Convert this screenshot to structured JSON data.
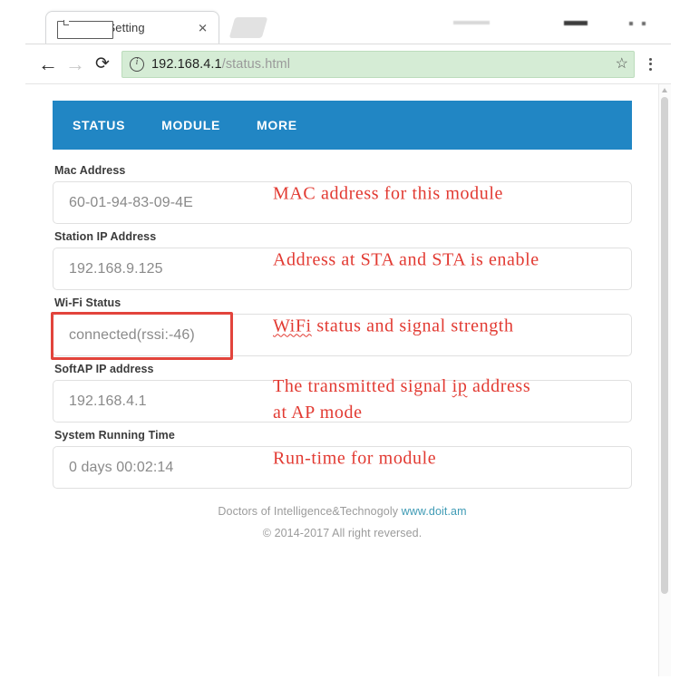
{
  "browser": {
    "tab": {
      "title": "Wi-Fi Setting",
      "close_label": "✕",
      "favicon": "page-icon"
    },
    "new_tab_label": "",
    "window_controls": {
      "minimize": "minimize-icon",
      "maximize": "maximize-icon",
      "close": "close-icon"
    },
    "toolbar": {
      "back_label": "←",
      "forward_label": "→",
      "reload_label": "⟳",
      "site_info_icon": "info-circle-icon",
      "url_host": "192.168.4.1",
      "url_path": "/status.html",
      "bookmark_label": "☆",
      "menu_icon": "three-dot-menu-icon"
    }
  },
  "nav": {
    "items": [
      {
        "label": "STATUS",
        "active": true
      },
      {
        "label": "MODULE",
        "active": false
      },
      {
        "label": "MORE",
        "active": false
      }
    ]
  },
  "fields": [
    {
      "label": "Mac Address",
      "value": "60-01-94-83-09-4E",
      "annotation": "MAC address for this module",
      "highlighted": false
    },
    {
      "label": "Station IP Address",
      "value": "192.168.9.125",
      "annotation": "Address at STA and STA is enable",
      "highlighted": false
    },
    {
      "label": "Wi-Fi Status",
      "value": "connected(rssi:-46)",
      "annotation_prefix": "WiFi",
      "annotation_rest": " status and signal strength",
      "highlighted": true
    },
    {
      "label": "SoftAP IP address",
      "value": "192.168.4.1",
      "annotation_a": "The transmitted signal ",
      "annotation_b": "ip",
      "annotation_c": " address",
      "annotation_d": "at AP mode",
      "highlighted": false
    },
    {
      "label": "System Running Time",
      "value": "0 days 00:02:14",
      "annotation": "Run-time for module",
      "highlighted": false
    }
  ],
  "footer": {
    "company": "Doctors of Intelligence&Technogoly",
    "link": "www.doit.am",
    "copyright": "© 2014-2017 All right reversed."
  },
  "colors": {
    "navbar_blue": "#2186C4",
    "annotation_red": "#E23A32",
    "highlight_red": "#E2443C",
    "omnibox_green": "#D5ECD5",
    "footer_link": "#3F9BB5"
  }
}
